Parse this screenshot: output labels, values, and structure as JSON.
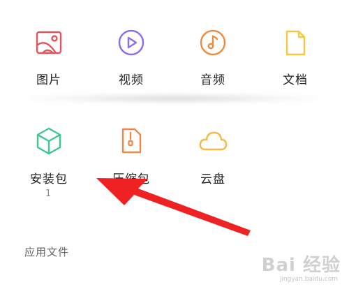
{
  "files": {
    "items": [
      {
        "label": "图片",
        "icon": "image-icon",
        "color": "#e2555a"
      },
      {
        "label": "视频",
        "icon": "video-icon",
        "color": "#8a6cf0"
      },
      {
        "label": "音频",
        "icon": "audio-icon",
        "color": "#f08a3a"
      },
      {
        "label": "文档",
        "icon": "document-icon",
        "color": "#f5c842"
      },
      {
        "label": "安装包",
        "icon": "package-icon",
        "color": "#3cc98e",
        "count": "1"
      },
      {
        "label": "压缩包",
        "icon": "zip-icon",
        "color": "#f0884a"
      },
      {
        "label": "云盘",
        "icon": "cloud-icon",
        "color": "#f5b84a"
      }
    ]
  },
  "section": {
    "title": "应用文件"
  },
  "annotation": {
    "arrow_color": "#ee2222"
  },
  "watermark": {
    "logo": "Bai 经验",
    "url": "jingyan.baidu.com"
  }
}
